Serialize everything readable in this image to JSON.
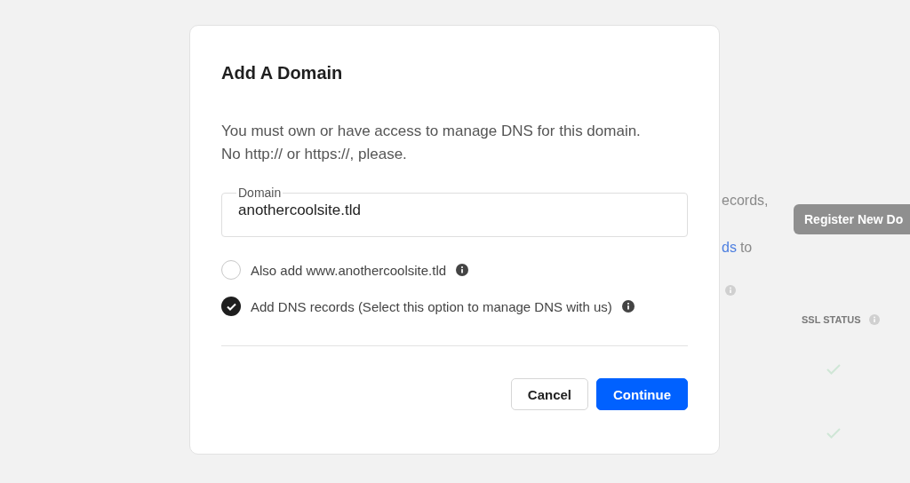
{
  "background": {
    "line_1": "ecords,",
    "link": "ds",
    "line_2": "to",
    "register_button": "Register New Do",
    "columns": [
      {
        "info": true
      },
      {
        "label": "SSL STATUS",
        "info": true
      }
    ],
    "rows": [
      {
        "ssl_ok": true
      },
      {
        "ssl_ok": true
      }
    ]
  },
  "dialog": {
    "title": "Add A Domain",
    "description": [
      "You must own or have access to manage DNS for this domain.",
      "No http:// or https://, please."
    ],
    "field": {
      "label": "Domain",
      "value": "anothercoolsite.tld"
    },
    "options": [
      {
        "label": "Also add www.anothercoolsite.tld",
        "checked": false,
        "info": true
      },
      {
        "label": "Add DNS records (Select this option to manage DNS with us)",
        "checked": true,
        "info": true
      }
    ],
    "buttons": [
      {
        "label": "Cancel",
        "kind": "secondary"
      },
      {
        "label": "Continue",
        "kind": "primary"
      }
    ]
  }
}
